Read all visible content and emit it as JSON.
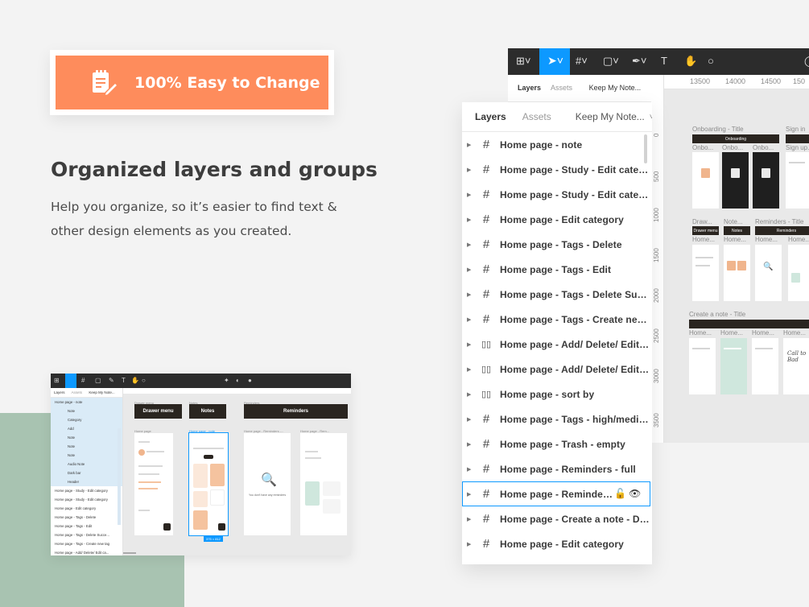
{
  "badge": {
    "text": "100% Easy to Change",
    "icon": "edit-note-icon",
    "color": "#fe8c5c"
  },
  "heading": "Organized layers and groups",
  "description": "Help you organize, so it’s easier to find text & other design elements as you created.",
  "big_figma": {
    "tabs": [
      "Layers",
      "Assets"
    ],
    "page": "Keep My Note...",
    "ruler_x": [
      "13500",
      "14000",
      "14500",
      "150"
    ],
    "ruler_y": [
      "0",
      "500",
      "1000",
      "1500",
      "2000",
      "2500",
      "3000",
      "3500",
      "4000"
    ],
    "sections": [
      {
        "label": "Onboarding - Title",
        "bar": "Onboarding"
      },
      {
        "label": "Sign in",
        "bar": ""
      },
      {
        "label": "Reminders - Title",
        "bar": "Reminders"
      },
      {
        "label": "Create a note - Title",
        "bar": ""
      }
    ],
    "frame_labels": [
      "Onbo...",
      "Onbo...",
      "Onbo...",
      "Sign up...",
      "Draw...",
      "Note...",
      "Home...",
      "Home...",
      "Home...",
      "Home...",
      "Home...",
      "Home...",
      "Home...",
      "Home...",
      "Home..."
    ],
    "small_bars": [
      "Drawer menu",
      "Notes",
      "Reminders"
    ]
  },
  "layers_panel": {
    "tabs": [
      "Layers",
      "Assets"
    ],
    "page": "Keep My Note...",
    "layers": [
      {
        "name": "Home page - note",
        "icon": "frame-icon",
        "hover": false
      },
      {
        "name": "Home page - Study - Edit category",
        "icon": "frame-icon",
        "hover": false
      },
      {
        "name": "Home page - Study - Edit category",
        "icon": "frame-icon",
        "hover": false
      },
      {
        "name": "Home page - Edit category",
        "icon": "frame-icon",
        "hover": false
      },
      {
        "name": "Home page - Tags - Delete",
        "icon": "frame-icon",
        "hover": false
      },
      {
        "name": "Home page - Tags - Edit",
        "icon": "frame-icon",
        "hover": false
      },
      {
        "name": "Home page - Tags - Delete Succe...",
        "icon": "frame-icon",
        "hover": false
      },
      {
        "name": "Home page - Tags - Create new tag",
        "icon": "frame-icon",
        "hover": false
      },
      {
        "name": "Home page - Add/ Delete/ Edit ca...",
        "icon": "columns-icon",
        "hover": false
      },
      {
        "name": "Home page - Add/ Delete/ Edit ca...",
        "icon": "columns-icon",
        "hover": false
      },
      {
        "name": "Home page - sort by",
        "icon": "columns-icon",
        "hover": false
      },
      {
        "name": "Home page - Tags - high/medium...",
        "icon": "frame-icon",
        "hover": false
      },
      {
        "name": "Home page - Trash - empty",
        "icon": "frame-icon",
        "hover": false
      },
      {
        "name": "Home page - Reminders - full",
        "icon": "frame-icon",
        "hover": false
      },
      {
        "name": "Home page - Reminders ...",
        "icon": "frame-icon",
        "hover": true
      },
      {
        "name": "Home page - Create a note - Draw...",
        "icon": "frame-icon",
        "hover": false
      },
      {
        "name": "Home page - Edit category",
        "icon": "frame-icon",
        "hover": false
      }
    ]
  },
  "mini_figma": {
    "tabs": [
      "Layers",
      "Assets",
      "Keep My Note..."
    ],
    "layers": [
      {
        "name": "Home page - note",
        "child": false,
        "sel": true
      },
      {
        "name": "Note",
        "child": true,
        "sel": true
      },
      {
        "name": "Category",
        "child": true,
        "sel": true
      },
      {
        "name": "Add",
        "child": true,
        "sel": true
      },
      {
        "name": "Note",
        "child": true,
        "sel": true
      },
      {
        "name": "Note",
        "child": true,
        "sel": true
      },
      {
        "name": "Note",
        "child": true,
        "sel": true
      },
      {
        "name": "Audio Note",
        "child": true,
        "sel": true
      },
      {
        "name": "Dark bar",
        "child": true,
        "sel": true
      },
      {
        "name": "Header",
        "child": true,
        "sel": true
      },
      {
        "name": "Home page - Study - Edit category",
        "child": false,
        "sel": false
      },
      {
        "name": "Home page - Study - Edit category",
        "child": false,
        "sel": false
      },
      {
        "name": "Home page - Edit category",
        "child": false,
        "sel": false
      },
      {
        "name": "Home page - Tags - Delete",
        "child": false,
        "sel": false
      },
      {
        "name": "Home page - Tags - Edit",
        "child": false,
        "sel": false
      },
      {
        "name": "Home page - Tags - Delete Succe...",
        "child": false,
        "sel": false
      },
      {
        "name": "Home page - Tags - Create new tag",
        "child": false,
        "sel": false
      },
      {
        "name": "Home page - Add/ Delete/ Edit ca...",
        "child": false,
        "sel": false
      }
    ],
    "section_labels": [
      "Drawer menu",
      "Notes",
      "Reminders"
    ],
    "frame_labels": [
      "Home page",
      "Home page - note",
      "Home page - Reminders -...",
      "Home page - Rem..."
    ],
    "size_tag": "375 × 812",
    "empty_text": "You don't have any reminders"
  },
  "colors": {
    "accent": "#0d99ff",
    "orange": "#fe8c5c",
    "green_block": "#a8c3b1",
    "dark_toolbar": "#2c2c2c"
  }
}
